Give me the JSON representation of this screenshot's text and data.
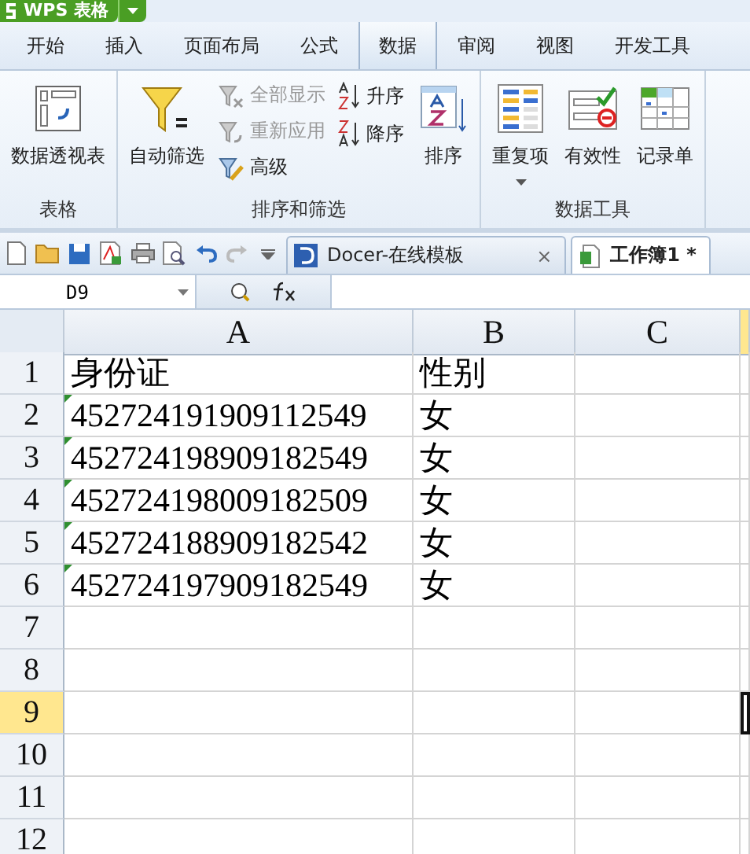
{
  "app_button": {
    "title": "WPS 表格"
  },
  "menu_tabs": [
    {
      "label": "开始",
      "selected": false
    },
    {
      "label": "插入",
      "selected": false
    },
    {
      "label": "页面布局",
      "selected": false
    },
    {
      "label": "公式",
      "selected": false
    },
    {
      "label": "数据",
      "selected": true
    },
    {
      "label": "审阅",
      "selected": false
    },
    {
      "label": "视图",
      "selected": false
    },
    {
      "label": "开发工具",
      "selected": false
    }
  ],
  "ribbon_groups": [
    {
      "title": "表格",
      "items": [
        {
          "kind": "large",
          "label": "数据透视表",
          "disabled": false
        }
      ]
    },
    {
      "title": "排序和筛选",
      "items": [
        {
          "kind": "large",
          "label": "自动筛选",
          "disabled": false
        },
        {
          "kind": "small",
          "label": "全部显示",
          "disabled": true
        },
        {
          "kind": "small",
          "label": "重新应用",
          "disabled": true
        },
        {
          "kind": "small",
          "label": "高级",
          "disabled": false
        },
        {
          "kind": "small",
          "label": "升序",
          "disabled": false
        },
        {
          "kind": "small",
          "label": "降序",
          "disabled": false
        },
        {
          "kind": "large",
          "label": "排序",
          "disabled": false
        }
      ]
    },
    {
      "title": "数据工具",
      "items": [
        {
          "kind": "large",
          "label": "重复项",
          "disabled": false,
          "dropdown": true
        },
        {
          "kind": "large",
          "label": "有效性",
          "disabled": false
        },
        {
          "kind": "large",
          "label": "记录单",
          "disabled": false
        }
      ]
    }
  ],
  "doc_tabs": [
    {
      "kind": "docer",
      "label": "Docer-在线模板",
      "selected": false,
      "close": "×"
    },
    {
      "kind": "sheet",
      "label": "工作簿1 *",
      "selected": true
    }
  ],
  "name_box": {
    "value": "D9"
  },
  "columns": [
    {
      "label": "A",
      "selected": false
    },
    {
      "label": "B",
      "selected": false
    },
    {
      "label": "C",
      "selected": false
    },
    {
      "selected": true
    }
  ],
  "rows": [
    {
      "label": "1",
      "selected": false,
      "cells": [
        {
          "text": "身份证",
          "flagged": false
        },
        {
          "text": "性别",
          "flagged": false
        }
      ]
    },
    {
      "label": "2",
      "selected": false,
      "cells": [
        {
          "text": "452724191909112549",
          "flagged": true
        },
        {
          "text": "女",
          "flagged": false
        }
      ]
    },
    {
      "label": "3",
      "selected": false,
      "cells": [
        {
          "text": "452724198909182549",
          "flagged": true
        },
        {
          "text": "女",
          "flagged": false
        }
      ]
    },
    {
      "label": "4",
      "selected": false,
      "cells": [
        {
          "text": "452724198009182509",
          "flagged": true
        },
        {
          "text": "女",
          "flagged": false
        }
      ]
    },
    {
      "label": "5",
      "selected": false,
      "cells": [
        {
          "text": "452724188909182542",
          "flagged": true
        },
        {
          "text": "女",
          "flagged": false
        }
      ]
    },
    {
      "label": "6",
      "selected": false,
      "cells": [
        {
          "text": "452724197909182549",
          "flagged": true
        },
        {
          "text": "女",
          "flagged": false
        }
      ]
    },
    {
      "label": "7",
      "selected": false,
      "cells": []
    },
    {
      "label": "8",
      "selected": false,
      "cells": []
    },
    {
      "label": "9",
      "selected": true,
      "cells": []
    },
    {
      "label": "10",
      "selected": false,
      "cells": []
    },
    {
      "label": "11",
      "selected": false,
      "cells": []
    },
    {
      "label": "12",
      "selected": false,
      "cells": []
    }
  ]
}
